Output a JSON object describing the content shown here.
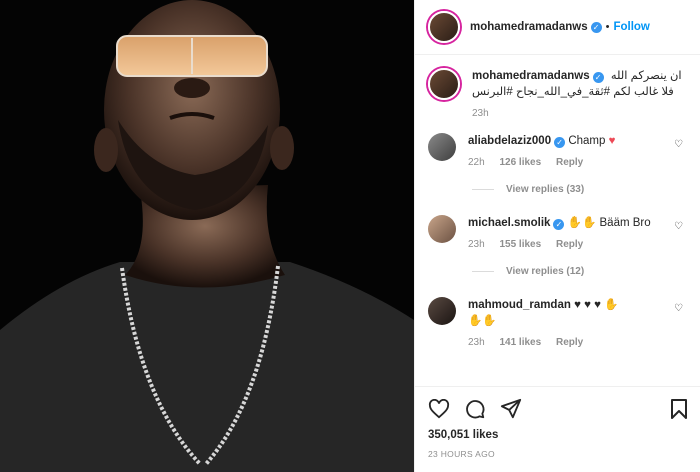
{
  "header": {
    "username": "mohamedramadanws",
    "separator": "•",
    "follow_label": "Follow"
  },
  "caption": {
    "username": "mohamedramadanws",
    "text_line1": "ان ينصركم الله",
    "text_line2": "فلا غالب لكم #ثقة_في_الله_نجاح #البرنس",
    "time": "23h"
  },
  "comments": [
    {
      "username": "aliabdelaziz000",
      "text": "Champ",
      "time": "22h",
      "likes": "126 likes",
      "reply": "Reply",
      "view_replies": "View replies (33)"
    },
    {
      "username": "michael.smolik",
      "text": "✋✋ Bääm Bro",
      "time": "23h",
      "likes": "155 likes",
      "reply": "Reply",
      "view_replies": "View replies (12)"
    },
    {
      "username": "mahmoud_ramdan",
      "text": "♥ ♥ ♥ ✋",
      "text_line2": "✋✋",
      "time": "23h",
      "likes": "141 likes",
      "reply": "Reply"
    }
  ],
  "footer": {
    "likes": "350,051 likes",
    "time_ago": "23 HOURS AGO"
  },
  "icons": [
    "heart-icon",
    "comment-icon",
    "share-icon",
    "bookmark-icon",
    "verified-badge-icon"
  ],
  "colors": {
    "accent": "#0095f6",
    "verified": "#3897f0",
    "heart": "#ed4956",
    "muted": "#8e8e8e"
  }
}
